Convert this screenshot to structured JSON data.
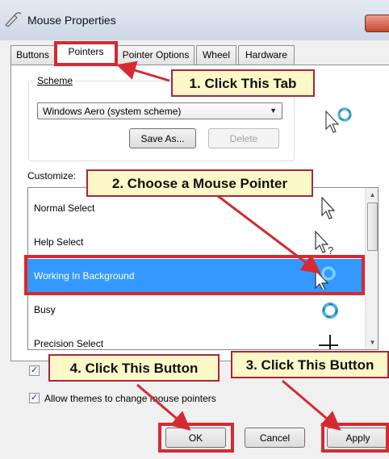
{
  "window": {
    "title": "Mouse Properties",
    "title_icon": "mouse-icon",
    "close_icon": "close-icon"
  },
  "tabs": [
    {
      "label": "Buttons"
    },
    {
      "label": "Pointers"
    },
    {
      "label": "Pointer Options"
    },
    {
      "label": "Wheel"
    },
    {
      "label": "Hardware"
    }
  ],
  "scheme": {
    "label": "Scheme",
    "selected": "Windows Aero (system scheme)",
    "save_as": "Save As...",
    "delete": "Delete"
  },
  "customize": {
    "label": "Customize:",
    "items": [
      {
        "label": "Normal Select",
        "icon": "arrow-cursor-icon"
      },
      {
        "label": "Help Select",
        "icon": "help-cursor-icon"
      },
      {
        "label": "Working In Background",
        "icon": "working-cursor-icon",
        "selected": true
      },
      {
        "label": "Busy",
        "icon": "busy-cursor-icon"
      },
      {
        "label": "Precision Select",
        "icon": "crosshair-cursor-icon"
      }
    ]
  },
  "options": {
    "enable_shadow_checked": true,
    "allow_themes": "Allow themes to change mouse pointers",
    "allow_themes_checked": true
  },
  "buttons": {
    "ok": "OK",
    "cancel": "Cancel",
    "apply": "Apply"
  },
  "annotations": {
    "step1": "1. Click This Tab",
    "step2": "2. Choose a Mouse Pointer",
    "step3": "3. Click This Button",
    "step4": "4. Click This Button",
    "color": "#d42a32"
  }
}
